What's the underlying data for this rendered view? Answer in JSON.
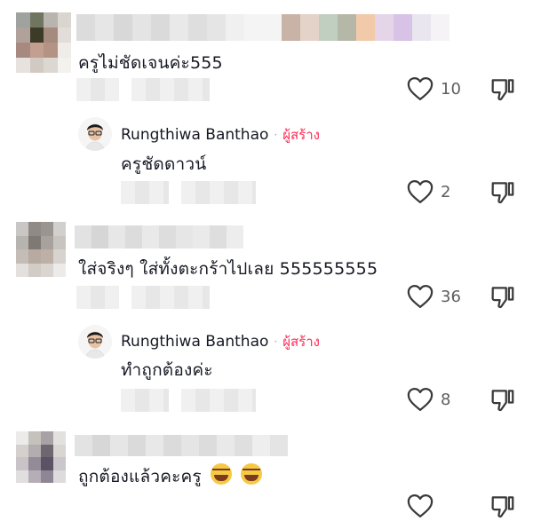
{
  "comments": [
    {
      "text": "ครูไม่ชัดเจนค่ะ555",
      "likes": "10",
      "reply": {
        "author": "Rungthiwa Banthao",
        "separator": "·",
        "badge": "ผู้สร้าง",
        "text": "ครูชัดดาวน์",
        "likes": "2"
      }
    },
    {
      "text": "ใส่จริงๆ ใส่ทั้งตะกร้าไปเลย 555555555",
      "likes": "36",
      "reply": {
        "author": "Rungthiwa Banthao",
        "separator": "·",
        "badge": "ผู้สร้าง",
        "text": "ทำถูกต้องค่ะ",
        "likes": "8"
      }
    },
    {
      "text": "ถูกต้องแล้วคะครู",
      "emoji": [
        "tears-of-joy-emoji",
        "tears-of-joy-emoji"
      ],
      "likes": ""
    }
  ],
  "colors": {
    "creator_badge": "#fe2c55",
    "text": "#161823",
    "count": "#5f5f5f",
    "icon": "#3a3a3a"
  },
  "icons": [
    "heart-icon",
    "dislike-icon",
    "tears-of-joy-emoji"
  ]
}
